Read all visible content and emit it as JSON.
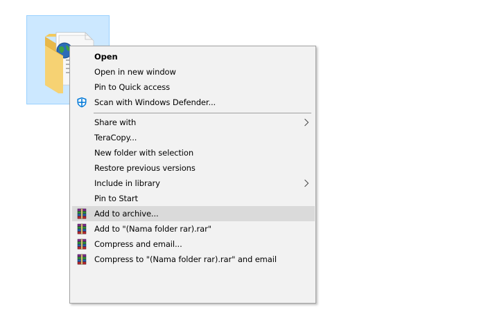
{
  "menu": {
    "items": [
      {
        "label": "Open",
        "icon": null,
        "bold": true,
        "submenu": false,
        "highlighted": false
      },
      {
        "label": "Open in new window",
        "icon": null,
        "bold": false,
        "submenu": false,
        "highlighted": false
      },
      {
        "label": "Pin to Quick access",
        "icon": null,
        "bold": false,
        "submenu": false,
        "highlighted": false
      },
      {
        "label": "Scan with Windows Defender...",
        "icon": "windows-defender-icon",
        "bold": false,
        "submenu": false,
        "highlighted": false
      },
      {
        "label": "Share with",
        "icon": null,
        "bold": false,
        "submenu": true,
        "highlighted": false
      },
      {
        "label": "TeraCopy...",
        "icon": null,
        "bold": false,
        "submenu": false,
        "highlighted": false
      },
      {
        "label": "New folder with selection",
        "icon": null,
        "bold": false,
        "submenu": false,
        "highlighted": false
      },
      {
        "label": "Restore previous versions",
        "icon": null,
        "bold": false,
        "submenu": false,
        "highlighted": false
      },
      {
        "label": "Include in library",
        "icon": null,
        "bold": false,
        "submenu": true,
        "highlighted": false
      },
      {
        "label": "Pin to Start",
        "icon": null,
        "bold": false,
        "submenu": false,
        "highlighted": false
      },
      {
        "label": "Add to archive...",
        "icon": "winrar-icon",
        "bold": false,
        "submenu": false,
        "highlighted": true
      },
      {
        "label": "Add to \"(Nama folder rar).rar\"",
        "icon": "winrar-icon",
        "bold": false,
        "submenu": false,
        "highlighted": false
      },
      {
        "label": "Compress and email...",
        "icon": "winrar-icon",
        "bold": false,
        "submenu": false,
        "highlighted": false
      },
      {
        "label": "Compress to \"(Nama folder rar).rar\" and email",
        "icon": "winrar-icon",
        "bold": false,
        "submenu": false,
        "highlighted": false
      }
    ]
  },
  "colors": {
    "menu_background": "#f2f2f2",
    "highlight": "#dadada",
    "selection_tile": "#cce8ff",
    "selection_border": "#99d1ff",
    "defender_blue": "#0078d7"
  }
}
